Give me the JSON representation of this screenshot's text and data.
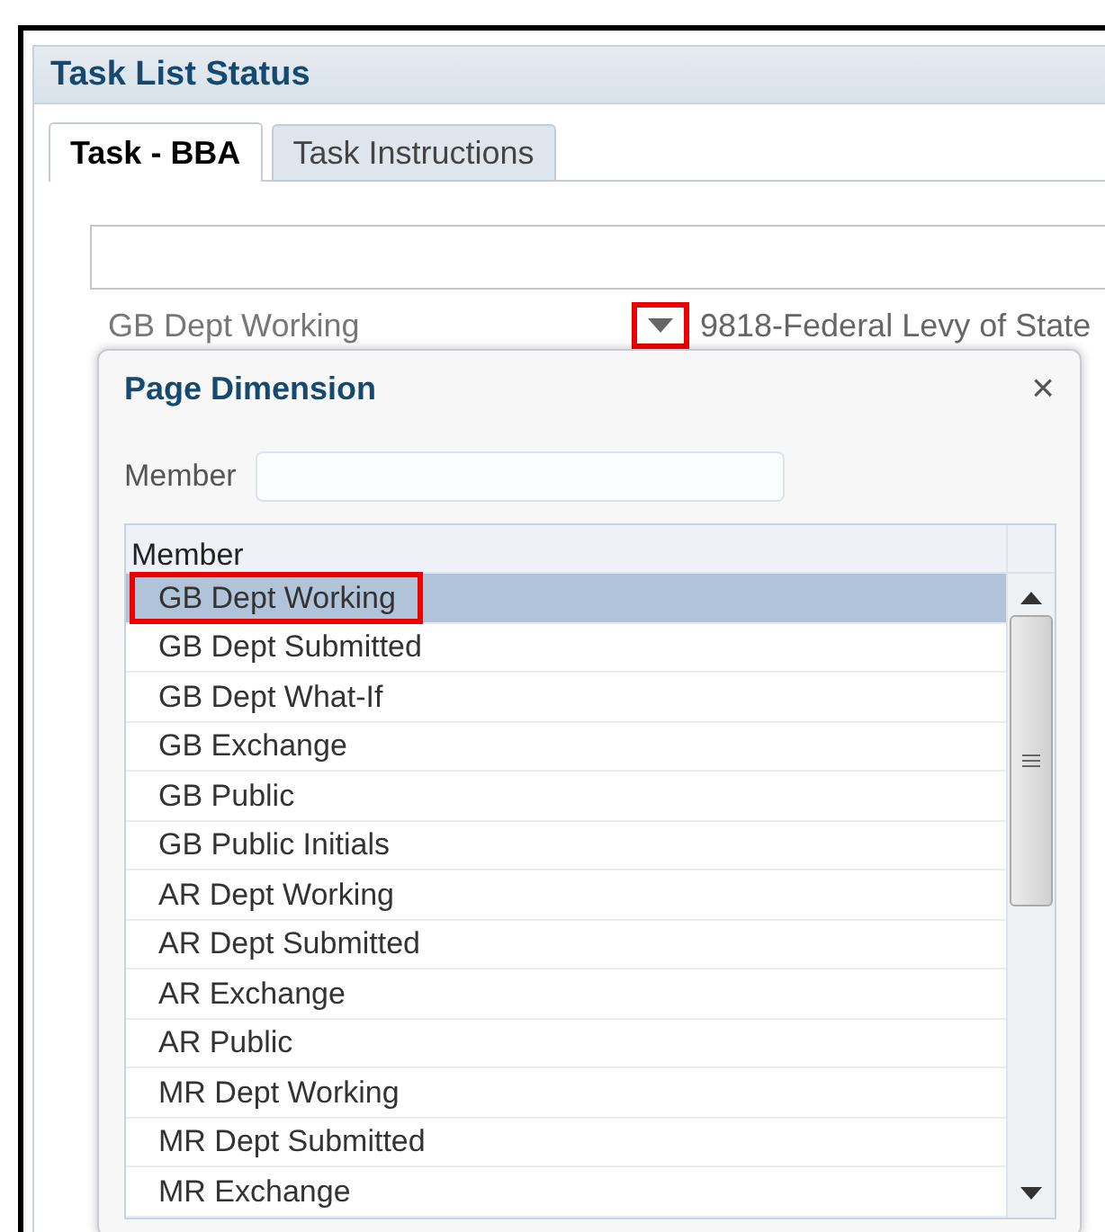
{
  "panel": {
    "title": "Task List Status"
  },
  "tabs": [
    {
      "label": "Task - BBA",
      "selected": true
    },
    {
      "label": "Task Instructions",
      "selected": false
    }
  ],
  "page_selector": {
    "value": "GB Dept Working",
    "dropdown_highlighted": true,
    "next_value": "9818-Federal Levy of State"
  },
  "dialog": {
    "title": "Page Dimension",
    "close": "×",
    "search_label": "Member",
    "column": "Member",
    "rows": [
      {
        "label": "GB Dept Working",
        "selected": true,
        "highlighted": true
      },
      {
        "label": "GB Dept Submitted",
        "selected": false,
        "highlighted": false
      },
      {
        "label": "GB Dept What-If",
        "selected": false,
        "highlighted": false
      },
      {
        "label": "GB Exchange",
        "selected": false,
        "highlighted": false
      },
      {
        "label": "GB Public",
        "selected": false,
        "highlighted": false
      },
      {
        "label": "GB Public Initials",
        "selected": false,
        "highlighted": false
      },
      {
        "label": "AR Dept Working",
        "selected": false,
        "highlighted": false
      },
      {
        "label": "AR Dept Submitted",
        "selected": false,
        "highlighted": false
      },
      {
        "label": "AR Exchange",
        "selected": false,
        "highlighted": false
      },
      {
        "label": "AR Public",
        "selected": false,
        "highlighted": false
      },
      {
        "label": "MR Dept Working",
        "selected": false,
        "highlighted": false
      },
      {
        "label": "MR Dept Submitted",
        "selected": false,
        "highlighted": false
      },
      {
        "label": "MR Exchange",
        "selected": false,
        "highlighted": false
      }
    ]
  }
}
